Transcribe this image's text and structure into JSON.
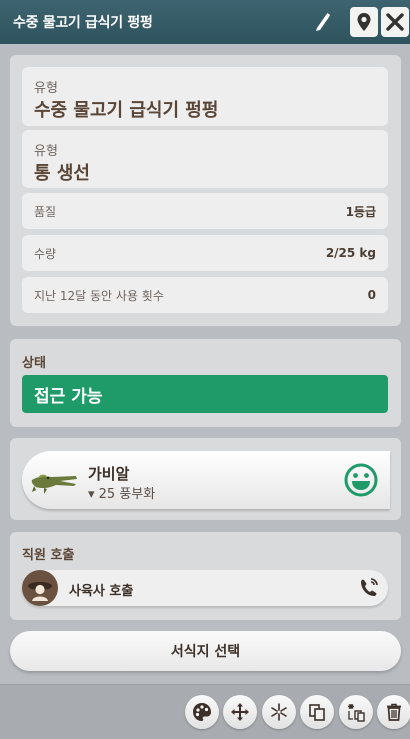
{
  "window": {
    "title": "수중 물고기 급식기 펑펑"
  },
  "info": {
    "type1_label": "유형",
    "type1_value": "수중 물고기 급식기 펑펑",
    "type2_label": "유형",
    "type2_value": "통 생선",
    "quality_label": "품질",
    "quality_value": "1등급",
    "amount_label": "수량",
    "amount_value": "2/25 kg",
    "usage_label": "지난 12달 동안 사용 횟수",
    "usage_value": "0"
  },
  "state": {
    "title": "상태",
    "value": "접근 가능",
    "color": "#1e9b69"
  },
  "animal": {
    "name": "가비알",
    "detail": "▾ 25 풍부화",
    "mood_icon": "happy-face-icon",
    "mood_color": "#1e9b69"
  },
  "staff": {
    "title": "직원 호출",
    "call_label": "사육사 호출"
  },
  "buttons": {
    "select_habitat": "서식지 선택"
  },
  "toolbar": {
    "icons": [
      "palette-icon",
      "move-icon",
      "light-icon",
      "copy-icon",
      "clone-icon",
      "trash-icon"
    ]
  }
}
